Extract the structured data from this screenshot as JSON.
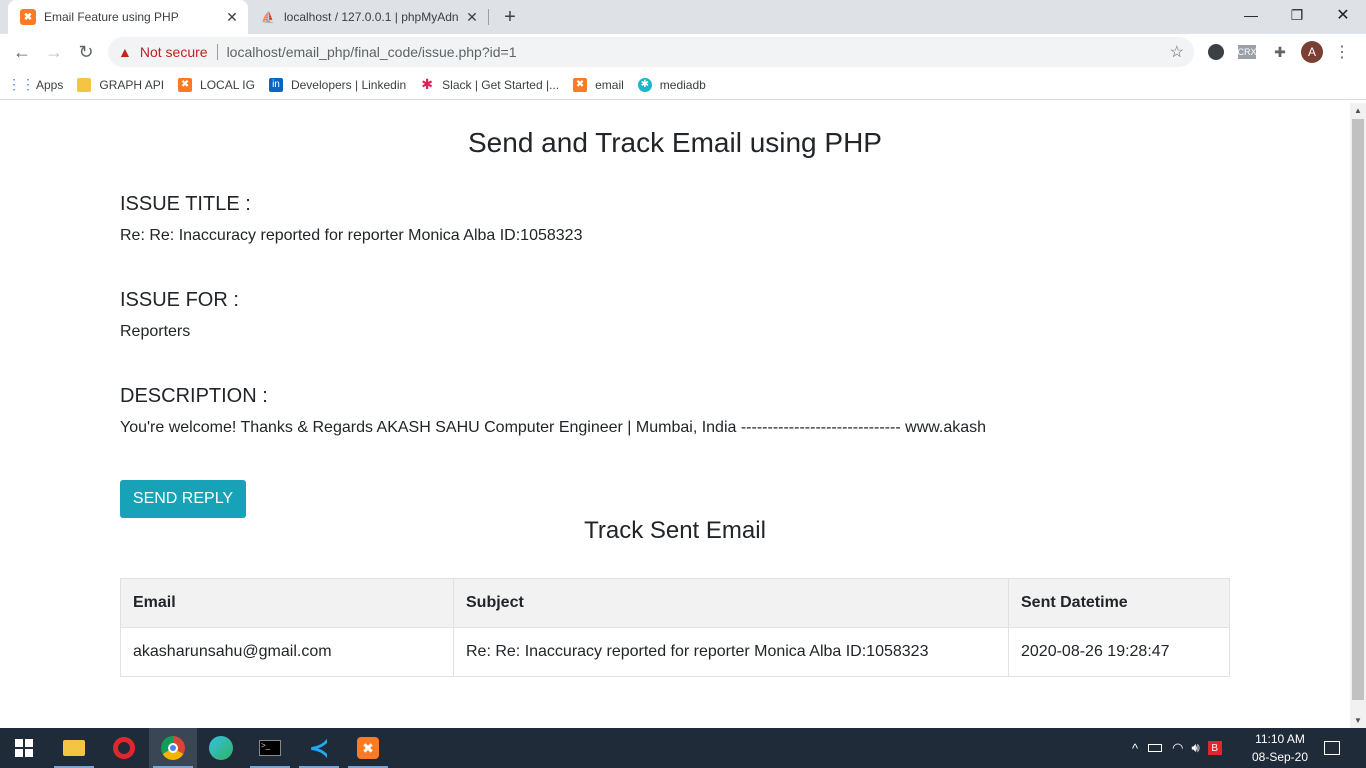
{
  "browser": {
    "tabs": [
      {
        "title": "Email Feature using PHP",
        "favicon": "xampp-icon",
        "active": true
      },
      {
        "title": "localhost / 127.0.0.1 | phpMyAdn",
        "favicon": "phpmyadmin-icon",
        "active": false
      }
    ],
    "address": {
      "security_label": "Not secure",
      "url": "localhost/email_php/final_code/issue.php?id=1"
    },
    "bookmarks": [
      {
        "label": "Apps",
        "icon": "apps-grid-icon"
      },
      {
        "label": "GRAPH API",
        "icon": "folder-icon"
      },
      {
        "label": "LOCAL IG",
        "icon": "xampp-icon"
      },
      {
        "label": "Developers | Linkedin",
        "icon": "linkedin-icon"
      },
      {
        "label": "Slack | Get Started |...",
        "icon": "slack-icon"
      },
      {
        "label": "email",
        "icon": "xampp-icon"
      },
      {
        "label": "mediadb",
        "icon": "mediadb-icon"
      }
    ],
    "profile_initial": "A",
    "extension_crx": "CRX"
  },
  "page": {
    "heading": "Send and Track Email using PHP",
    "issue_title_label": "ISSUE TITLE :",
    "issue_title_value": "Re: Re: Inaccuracy reported for reporter Monica Alba ID:1058323",
    "issue_for_label": "ISSUE FOR :",
    "issue_for_value": "Reporters",
    "description_label": "DESCRIPTION :",
    "description_value": "You're welcome! Thanks & Regards AKASH SAHU Computer Engineer | Mumbai, India ------------------------------ www.akash",
    "send_reply_label": "SEND REPLY",
    "track_heading": "Track Sent Email",
    "table": {
      "headers": [
        "Email",
        "Subject",
        "Sent Datetime"
      ],
      "rows": [
        [
          "akasharunsahu@gmail.com",
          "Re: Re: Inaccuracy reported for reporter Monica Alba ID:1058323",
          "2020-08-26 19:28:47"
        ]
      ]
    }
  },
  "taskbar": {
    "time": "11:10 AM",
    "date": "08-Sep-20"
  },
  "colors": {
    "accent_button": "#17a2b8",
    "not_secure": "#c5221f"
  }
}
